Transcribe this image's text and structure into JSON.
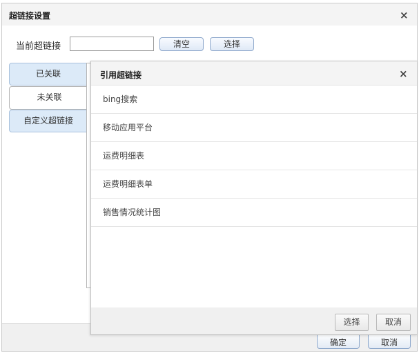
{
  "dialog": {
    "title": "超链接设置",
    "close_glyph": "×",
    "current_link_label": "当前超链接",
    "current_link_value": "",
    "clear_button": "清空",
    "choose_button": "选择",
    "tabs": [
      {
        "label": "已关联",
        "active": false
      },
      {
        "label": "未关联",
        "active": true
      },
      {
        "label": "自定义超链接",
        "active": false
      }
    ],
    "ok_button": "确定",
    "cancel_button": "取消"
  },
  "panel": {
    "title": "引用超链接",
    "close_glyph": "×",
    "items": [
      {
        "label": "bing搜索"
      },
      {
        "label": "移动应用平台"
      },
      {
        "label": "运费明细表"
      },
      {
        "label": "运费明细表单"
      },
      {
        "label": "销售情况统计图"
      }
    ],
    "select_button": "选择",
    "cancel_button": "取消"
  }
}
